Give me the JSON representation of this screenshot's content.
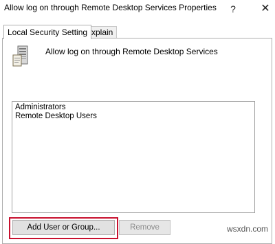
{
  "window": {
    "title": "Allow log on through Remote Desktop Services Properties",
    "help_glyph": "?",
    "close_glyph": "✕"
  },
  "tabs": [
    {
      "label": "Local Security Setting",
      "active": true
    },
    {
      "label": "Explain",
      "active": false
    }
  ],
  "policy": {
    "icon": "server-policy-icon",
    "name": "Allow log on through Remote Desktop Services"
  },
  "members": [
    "Administrators",
    "Remote Desktop Users"
  ],
  "buttons": {
    "add_label": "Add User or Group...",
    "remove_label": "Remove"
  },
  "watermark": "wsxdn.com",
  "colors": {
    "highlight": "#c8102e"
  }
}
